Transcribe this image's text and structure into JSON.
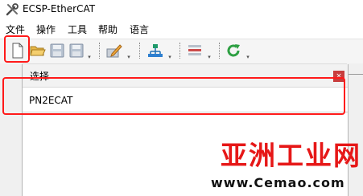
{
  "window": {
    "title": "ECSP-EtherCAT",
    "icon": "wrench-screwdriver-icon"
  },
  "menu": {
    "items": [
      "文件",
      "操作",
      "工具",
      "帮助",
      "语言"
    ]
  },
  "toolbar": {
    "buttons": [
      {
        "name": "new-file-button",
        "icon": "new-file-icon"
      },
      {
        "name": "open-folder-button",
        "icon": "folder-open-icon"
      },
      {
        "name": "save-button",
        "icon": "save-icon"
      },
      {
        "name": "save-as-button",
        "icon": "save-as-icon"
      },
      {
        "name": "edit-button",
        "icon": "edit-pencil-icon"
      },
      {
        "name": "network-button",
        "icon": "network-tree-icon"
      },
      {
        "name": "list-button",
        "icon": "list-icon"
      },
      {
        "name": "refresh-button",
        "icon": "refresh-icon"
      }
    ],
    "highlight_color": "#ff1a1a"
  },
  "dialog": {
    "title": "选择",
    "items": [
      "PN2ECAT"
    ],
    "close_icon": "close-icon"
  },
  "watermark": {
    "text": "亚洲工业网",
    "url": "www.Cemao.com",
    "color": "#e61717"
  }
}
